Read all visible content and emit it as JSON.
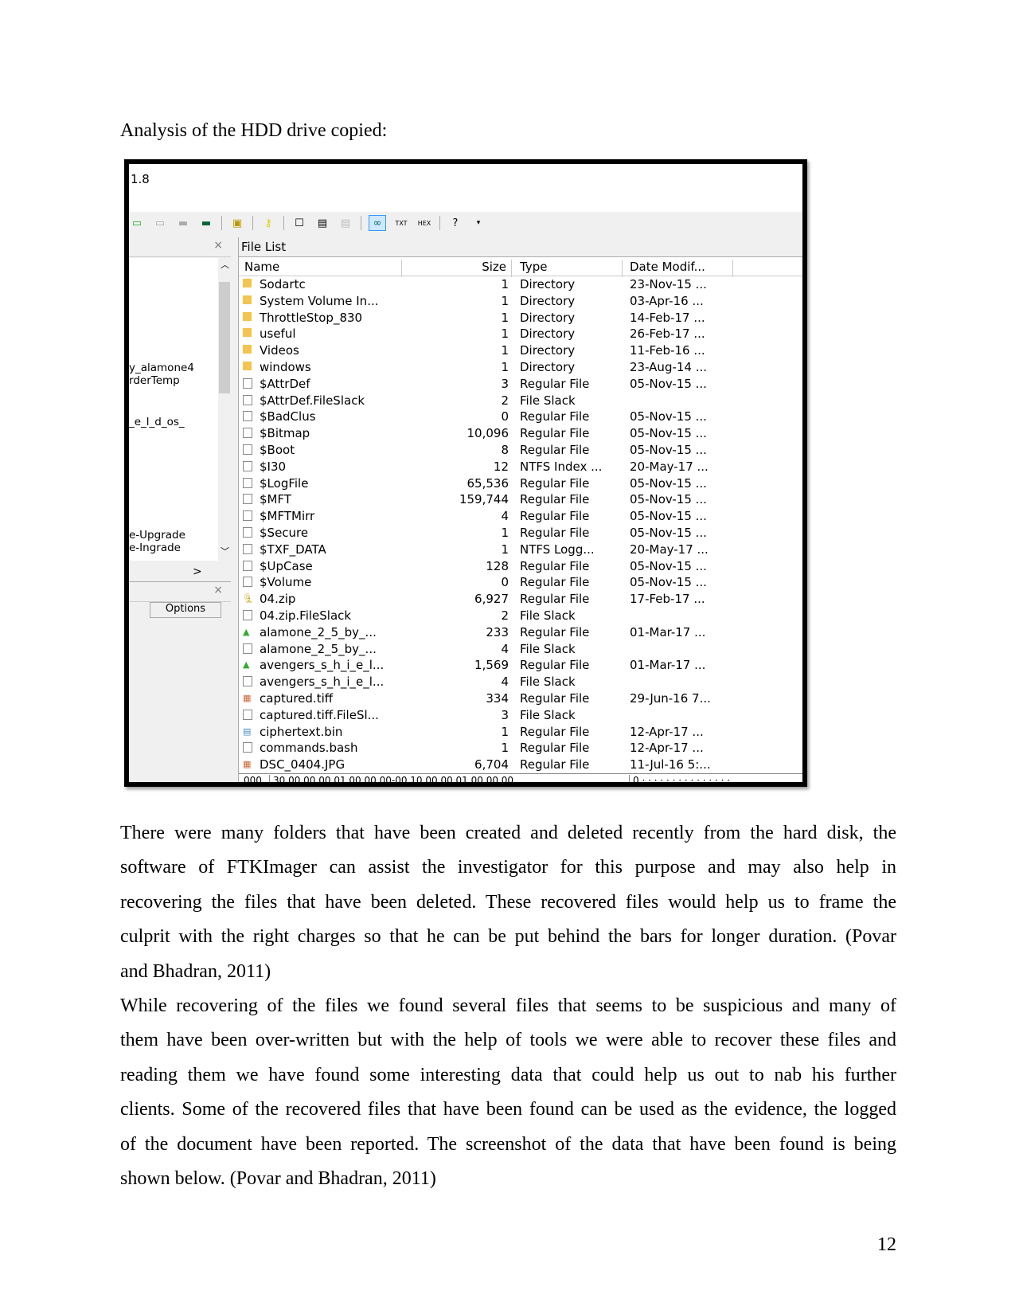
{
  "heading": "Analysis of the HDD drive copied:",
  "app": {
    "title": "1.8",
    "toolbar_icons": [
      "add-evidence-icon",
      "remove-evidence-icon",
      "remove-all-icon",
      "memory-icon",
      "export-icon",
      "key-icon",
      "new-page-icon",
      "document-icon",
      "disabled-doc-icon",
      "auto-view-icon",
      "text-view-icon",
      "hex-view-icon",
      "help-icon",
      "dropdown-icon"
    ],
    "left_items": [
      "y_alamone4",
      "rderTemp",
      "_e_l_d_os_",
      "e-Upgrade",
      "e-Ingrade"
    ],
    "options_label": "Options",
    "file_list_title": "File List",
    "columns": [
      "Name",
      "Size",
      "Type",
      "Date Modif..."
    ],
    "rows": [
      {
        "icon": "folder",
        "name": "Sodartc",
        "size": "1",
        "type": "Directory",
        "date": "23-Nov-15 ..."
      },
      {
        "icon": "folder",
        "name": "System Volume In...",
        "size": "1",
        "type": "Directory",
        "date": "03-Apr-16 ..."
      },
      {
        "icon": "folder",
        "name": "ThrottleStop_830",
        "size": "1",
        "type": "Directory",
        "date": "14-Feb-17 ..."
      },
      {
        "icon": "folder",
        "name": "useful",
        "size": "1",
        "type": "Directory",
        "date": "26-Feb-17 ..."
      },
      {
        "icon": "folder",
        "name": "Videos",
        "size": "1",
        "type": "Directory",
        "date": "11-Feb-16 ..."
      },
      {
        "icon": "folder",
        "name": "windows",
        "size": "1",
        "type": "Directory",
        "date": "23-Aug-14 ..."
      },
      {
        "icon": "file",
        "name": "$AttrDef",
        "size": "3",
        "type": "Regular File",
        "date": "05-Nov-15 ..."
      },
      {
        "icon": "file",
        "name": "$AttrDef.FileSlack",
        "size": "2",
        "type": "File Slack",
        "date": ""
      },
      {
        "icon": "file",
        "name": "$BadClus",
        "size": "0",
        "type": "Regular File",
        "date": "05-Nov-15 ..."
      },
      {
        "icon": "file",
        "name": "$Bitmap",
        "size": "10,096",
        "type": "Regular File",
        "date": "05-Nov-15 ..."
      },
      {
        "icon": "file",
        "name": "$Boot",
        "size": "8",
        "type": "Regular File",
        "date": "05-Nov-15 ..."
      },
      {
        "icon": "file",
        "name": "$I30",
        "size": "12",
        "type": "NTFS Index ...",
        "date": "20-May-17 ..."
      },
      {
        "icon": "file",
        "name": "$LogFile",
        "size": "65,536",
        "type": "Regular File",
        "date": "05-Nov-15 ..."
      },
      {
        "icon": "file",
        "name": "$MFT",
        "size": "159,744",
        "type": "Regular File",
        "date": "05-Nov-15 ..."
      },
      {
        "icon": "file",
        "name": "$MFTMirr",
        "size": "4",
        "type": "Regular File",
        "date": "05-Nov-15 ..."
      },
      {
        "icon": "file",
        "name": "$Secure",
        "size": "1",
        "type": "Regular File",
        "date": "05-Nov-15 ..."
      },
      {
        "icon": "file",
        "name": "$TXF_DATA",
        "size": "1",
        "type": "NTFS Logg...",
        "date": "20-May-17 ..."
      },
      {
        "icon": "file",
        "name": "$UpCase",
        "size": "128",
        "type": "Regular File",
        "date": "05-Nov-15 ..."
      },
      {
        "icon": "file",
        "name": "$Volume",
        "size": "0",
        "type": "Regular File",
        "date": "05-Nov-15 ..."
      },
      {
        "icon": "zip",
        "name": "04.zip",
        "size": "6,927",
        "type": "Regular File",
        "date": "17-Feb-17 ..."
      },
      {
        "icon": "file",
        "name": "04.zip.FileSlack",
        "size": "2",
        "type": "File Slack",
        "date": ""
      },
      {
        "icon": "android",
        "name": "alamone_2_5_by_...",
        "size": "233",
        "type": "Regular File",
        "date": "01-Mar-17 ..."
      },
      {
        "icon": "file",
        "name": "alamone_2_5_by_...",
        "size": "4",
        "type": "File Slack",
        "date": ""
      },
      {
        "icon": "android",
        "name": "avengers_s_h_i_e_l...",
        "size": "1,569",
        "type": "Regular File",
        "date": "01-Mar-17 ..."
      },
      {
        "icon": "file",
        "name": "avengers_s_h_i_e_l...",
        "size": "4",
        "type": "File Slack",
        "date": ""
      },
      {
        "icon": "image",
        "name": "captured.tiff",
        "size": "334",
        "type": "Regular File",
        "date": "29-Jun-16 7..."
      },
      {
        "icon": "file",
        "name": "captured.tiff.FileSl...",
        "size": "3",
        "type": "File Slack",
        "date": ""
      },
      {
        "icon": "bin",
        "name": "ciphertext.bin",
        "size": "1",
        "type": "Regular File",
        "date": "12-Apr-17 ..."
      },
      {
        "icon": "file",
        "name": "commands.bash",
        "size": "1",
        "type": "Regular File",
        "date": "12-Apr-17 ..."
      },
      {
        "icon": "image",
        "name": "DSC_0404.JPG",
        "size": "6,704",
        "type": "Regular File",
        "date": "11-Jul-16 5:..."
      }
    ],
    "hex": {
      "offset": "000",
      "bytes": "30 00 00 00 01 00 00 00-00 10 00 00 01 00 00 00",
      "ascii": "0 · · · · · · · · · · · · · · ·"
    }
  },
  "paragraphs": [
    [
      "There were many folders that have been created and deleted recently from the hard disk, the",
      "software of FTKImager can assist the investigator for this purpose and may also help in",
      "recovering the files that have been deleted. These recovered files would help us to frame the",
      "culprit with the right charges so that he can be put behind the bars for longer duration. (Povar",
      "and Bhadran, 2011)"
    ],
    [
      "While recovering of the files we found several files that seems to be suspicious and many of",
      "them have been over-written but with the help of tools we were able to recover these files and",
      "reading them we have found some interesting data that could help us out to nab his further",
      "clients. Some of the recovered files that have been found can be used as the evidence, the logged",
      "of the document have been reported. The screenshot of the data that have been found is being",
      "shown below. (Povar and Bhadran, 2011)"
    ]
  ],
  "page_number": "12"
}
